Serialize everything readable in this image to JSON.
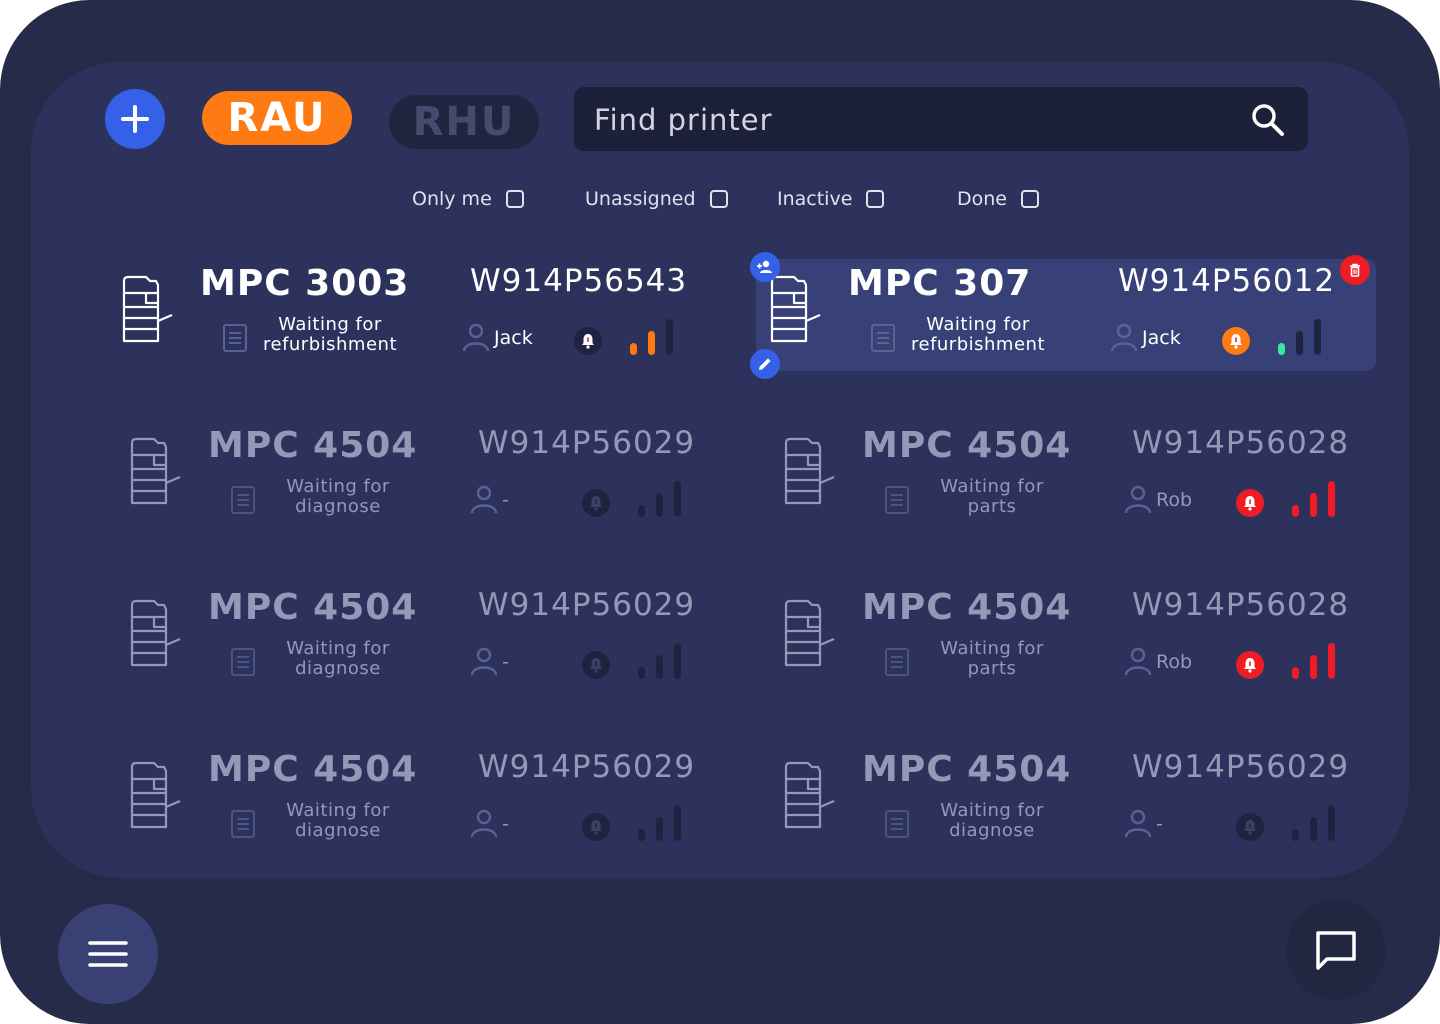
{
  "header": {
    "add_icon": "plus-icon",
    "tags": [
      {
        "label": "RAU",
        "active": true,
        "color": "#fe7b14"
      },
      {
        "label": "RHU",
        "active": false,
        "color": "#20243f"
      }
    ],
    "search": {
      "placeholder": "Find printer",
      "value": "",
      "icon": "search-icon"
    }
  },
  "filters": [
    {
      "label": "Only me",
      "checked": false
    },
    {
      "label": "Unassigned",
      "checked": false
    },
    {
      "label": "Inactive",
      "checked": false
    },
    {
      "label": "Done",
      "checked": false
    }
  ],
  "colors": {
    "background": "#262b4a",
    "panel": "#2c325b",
    "selected_card": "#374178",
    "accent_blue": "#3560e8",
    "orange": "#fe7b14",
    "red": "#ee1c24",
    "green": "#3ae6a2",
    "inactive": "#1f2340"
  },
  "printers": [
    {
      "model": "MPC 3003",
      "serial": "W914P56543",
      "status_line1": "Waiting for",
      "status_line2": "refurbishment",
      "assignee": "Jack",
      "alert": "white",
      "signal_level": 2,
      "signal_color": "orange",
      "selected": false,
      "active": true
    },
    {
      "model": "MPC 307",
      "serial": "W914P56012",
      "status_line1": "Waiting for",
      "status_line2": "refurbishment",
      "assignee": "Jack",
      "alert": "orange",
      "signal_level": 1,
      "signal_color": "green",
      "selected": true,
      "active": true
    },
    {
      "model": "MPC 4504",
      "serial": "W914P56029",
      "status_line1": "Waiting for",
      "status_line2": "diagnose",
      "assignee": "-",
      "alert": "none",
      "signal_level": 0,
      "signal_color": "none",
      "selected": false,
      "active": false
    },
    {
      "model": "MPC 4504",
      "serial": "W914P56028",
      "status_line1": "Waiting for",
      "status_line2": "parts",
      "assignee": "Rob",
      "alert": "red",
      "signal_level": 3,
      "signal_color": "red",
      "selected": false,
      "active": false
    },
    {
      "model": "MPC 4504",
      "serial": "W914P56029",
      "status_line1": "Waiting for",
      "status_line2": "diagnose",
      "assignee": "-",
      "alert": "none",
      "signal_level": 0,
      "signal_color": "none",
      "selected": false,
      "active": false
    },
    {
      "model": "MPC 4504",
      "serial": "W914P56028",
      "status_line1": "Waiting for",
      "status_line2": "parts",
      "assignee": "Rob",
      "alert": "red",
      "signal_level": 3,
      "signal_color": "red",
      "selected": false,
      "active": false
    },
    {
      "model": "MPC 4504",
      "serial": "W914P56029",
      "status_line1": "Waiting for",
      "status_line2": "diagnose",
      "assignee": "-",
      "alert": "none",
      "signal_level": 0,
      "signal_color": "none",
      "selected": false,
      "active": false
    },
    {
      "model": "MPC 4504",
      "serial": "W914P56029",
      "status_line1": "Waiting for",
      "status_line2": "diagnose",
      "assignee": "-",
      "alert": "none",
      "signal_level": 0,
      "signal_color": "none",
      "selected": false,
      "active": false
    }
  ],
  "selected_actions": {
    "assign_icon": "add-person-icon",
    "edit_icon": "pencil-icon",
    "delete_icon": "trash-icon"
  },
  "footer": {
    "menu_icon": "hamburger-menu-icon",
    "chat_icon": "chat-bubble-icon"
  }
}
